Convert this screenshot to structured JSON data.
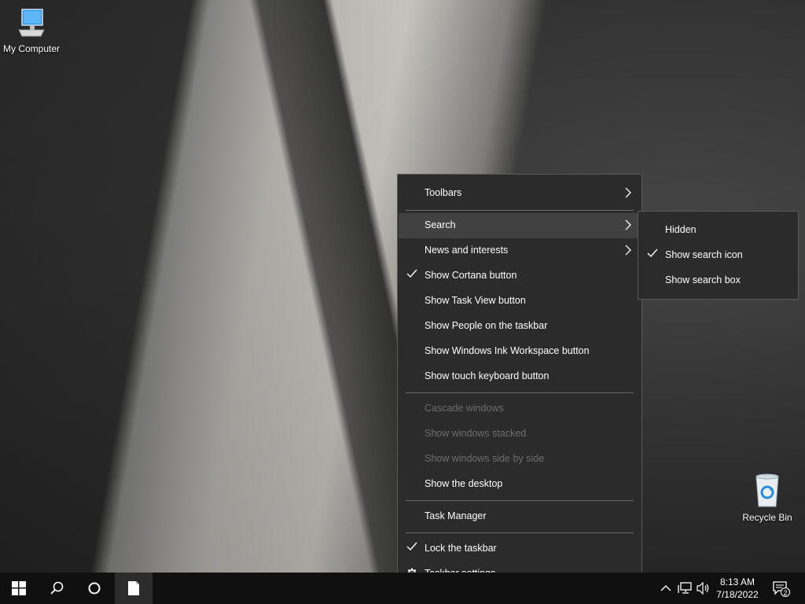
{
  "desktop": {
    "icons": [
      {
        "label": "My Computer",
        "icon": "computer-icon"
      },
      {
        "label": "Recycle Bin",
        "icon": "recycle-bin-icon"
      }
    ]
  },
  "context_menu": {
    "items": {
      "toolbars": "Toolbars",
      "search": "Search",
      "news": "News and interests",
      "cortana": "Show Cortana button",
      "taskview": "Show Task View button",
      "people": "Show People on the taskbar",
      "ink": "Show Windows Ink Workspace button",
      "touch_keyboard": "Show touch keyboard button",
      "cascade": "Cascade windows",
      "stacked": "Show windows stacked",
      "side_by_side": "Show windows side by side",
      "show_desktop": "Show the desktop",
      "task_manager": "Task Manager",
      "lock": "Lock the taskbar",
      "settings": "Taskbar settings"
    },
    "checked": [
      "cortana",
      "lock"
    ],
    "disabled": [
      "cascade",
      "stacked",
      "side_by_side"
    ],
    "highlighted": "search"
  },
  "search_submenu": {
    "items": {
      "hidden": "Hidden",
      "icon": "Show search icon",
      "box": "Show search box"
    },
    "checked": "icon"
  },
  "taskbar": {
    "time": "8:13 AM",
    "date": "7/18/2022",
    "notification_count": "2",
    "accent": "#101010"
  }
}
